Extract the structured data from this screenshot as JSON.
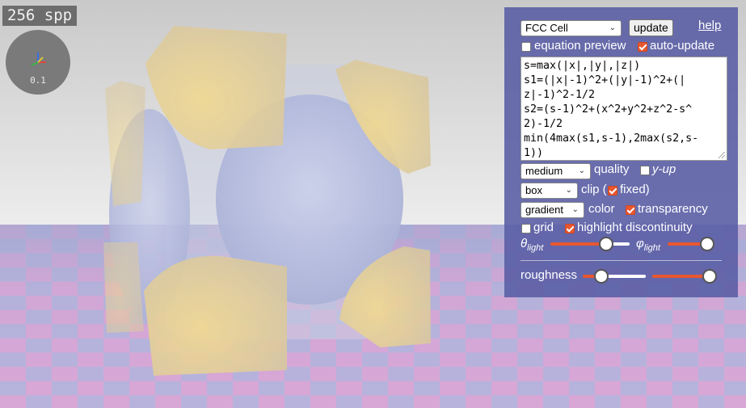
{
  "overlay": {
    "spp": "256 spp",
    "axes_value": "0.1"
  },
  "panel": {
    "preset": "FCC Cell",
    "update_label": "update",
    "help_label": "help",
    "equation_preview_label": "equation preview",
    "equation_preview_checked": false,
    "auto_update_label": "auto-update",
    "auto_update_checked": true,
    "equation_lines": [
      "s=max(|x|,|y|,|z|)",
      "s1=(|x|-1)^2+(|y|-1)^2+(|",
      "z|-1)^2-1/2",
      "s2=(s-1)^2+(x^2+y^2+z^2-s^",
      "2)-1/2",
      "min(4max(s1,s-1),2max(s2,s-",
      "1))"
    ],
    "quality": {
      "value": "medium",
      "label": "quality"
    },
    "y_up": {
      "label": "y-up",
      "checked": false
    },
    "clip": {
      "value": "box",
      "label": "clip (",
      "fixed_label": "fixed)",
      "fixed_checked": true
    },
    "color": {
      "value": "gradient",
      "label": "color"
    },
    "transparency": {
      "label": "transparency",
      "checked": true
    },
    "grid": {
      "label": "grid",
      "checked": false
    },
    "highlight": {
      "label": "highlight discontinuity",
      "checked": true
    },
    "theta_symbol": "θ",
    "theta_sub": "light",
    "theta_value": 0.7,
    "phi_symbol": "φ",
    "phi_sub": "light",
    "phi_value": 0.85,
    "roughness_label": "roughness",
    "roughness_value": 0.3,
    "roughness2_value": 0.9
  },
  "colors": {
    "panel_bg": "#585ca4",
    "accent": "#e8572f"
  }
}
